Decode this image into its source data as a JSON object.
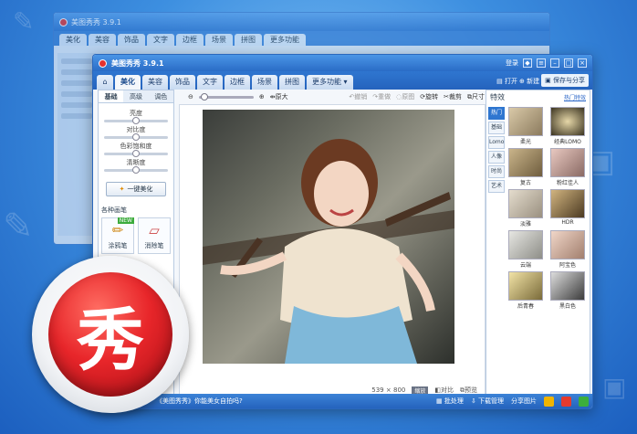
{
  "colors": {
    "accent": "#2f76d0",
    "logo_red": "#e8262a"
  },
  "back_window": {
    "title": "美图秀秀 3.9.1",
    "tabs": [
      "美化",
      "美容",
      "饰品",
      "文字",
      "边框",
      "场景",
      "拼图",
      "更多功能"
    ]
  },
  "window": {
    "title": "美图秀秀 3.9.1",
    "title_actions": [
      "登录"
    ],
    "tabs": [
      {
        "label": "",
        "icon": "home-icon"
      },
      {
        "label": "美化",
        "active": true
      },
      {
        "label": "美容"
      },
      {
        "label": "饰品"
      },
      {
        "label": "文字"
      },
      {
        "label": "边框"
      },
      {
        "label": "场景"
      },
      {
        "label": "拼图"
      },
      {
        "label": "更多功能"
      }
    ],
    "tab_actions": {
      "open": "打开",
      "new": "新建",
      "save": "保存与分享"
    }
  },
  "toolbar": {
    "original_size": "原大",
    "undo": "撤销",
    "redo": "重做",
    "reset": "原图",
    "rotate": "旋转",
    "crop": "裁剪",
    "resize": "尺寸"
  },
  "left_panel": {
    "subtabs": [
      "基础",
      "高级",
      "调色"
    ],
    "adjustments": [
      "亮度",
      "对比度",
      "色彩饱和度",
      "清晰度"
    ],
    "one_click": "一键美化",
    "brush_section": "各种画笔",
    "brushes": [
      {
        "label": "涂鸦笔",
        "new": "NEW"
      },
      {
        "label": "消除笔"
      }
    ]
  },
  "canvas": {
    "width": "539",
    "times": "×",
    "height": "800",
    "badge": "缩放",
    "compare": "对比",
    "preview": "预览"
  },
  "right_panel": {
    "title": "特效",
    "link": "热门特效",
    "categories": [
      "热门",
      "基础",
      "Lomo",
      "人像",
      "时尚",
      "艺术"
    ],
    "effects": [
      "柔光",
      "经典LOMO",
      "复古",
      "粉红佳人",
      "淡雅",
      "HDR",
      "云端",
      "阿宝色",
      "后青春",
      "黑白色"
    ]
  },
  "bottom_bar": {
    "left_text": "《美图秀秀》你能美女自拍吗?",
    "batch": "批处理",
    "download": "下载管理",
    "share": "分享图片"
  },
  "logo": {
    "character": "秀"
  }
}
